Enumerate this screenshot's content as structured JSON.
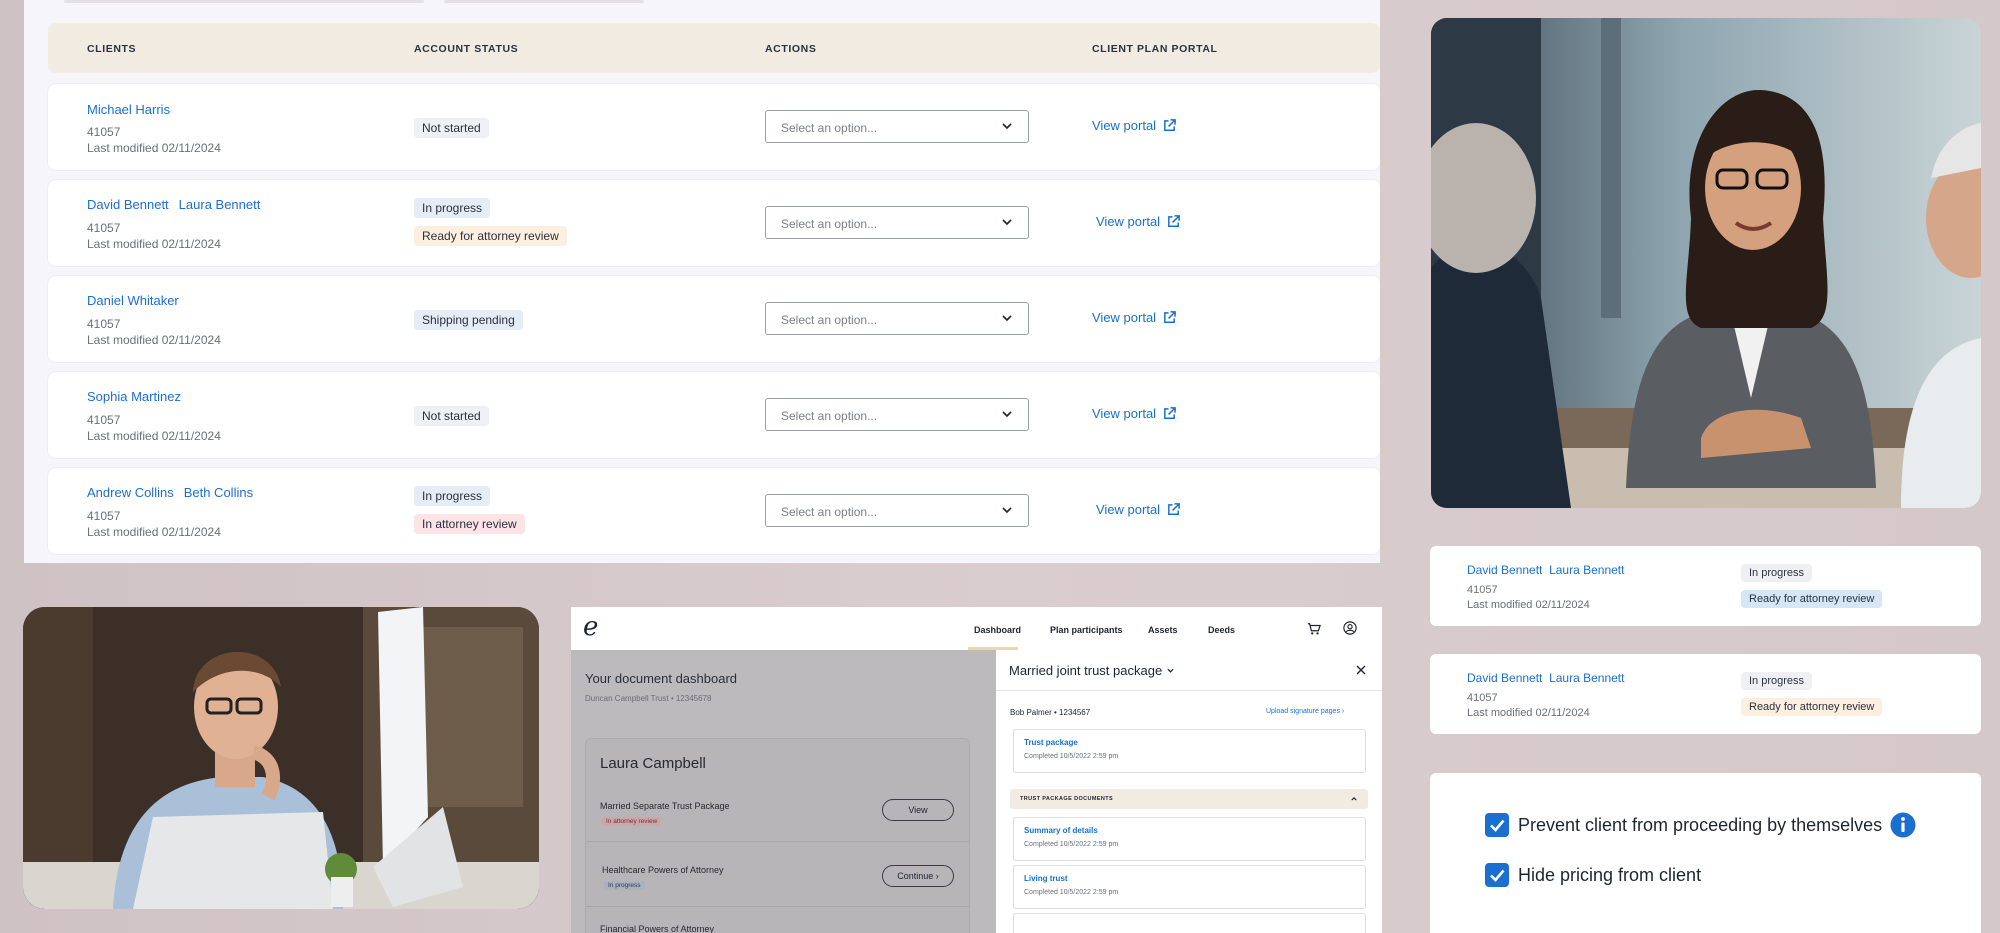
{
  "table": {
    "headers": {
      "clients": "CLIENTS",
      "status": "ACCOUNT STATUS",
      "actions": "ACTIONS",
      "portal": "CLIENT PLAN PORTAL"
    },
    "select_placeholder": "Select an option...",
    "portal_label": "View portal",
    "rows": [
      {
        "names": [
          "Michael Harris"
        ],
        "id": "41057",
        "modified": "Last modified 02/11/2024",
        "badges": [
          "Not started"
        ]
      },
      {
        "names": [
          "David Bennett",
          "Laura Bennett"
        ],
        "id": "41057",
        "modified": "Last modified 02/11/2024",
        "badges": [
          "In progress",
          "Ready for attorney review"
        ]
      },
      {
        "names": [
          "Daniel Whitaker"
        ],
        "id": "41057",
        "modified": "Last modified 02/11/2024",
        "badges": [
          "Shipping pending"
        ]
      },
      {
        "names": [
          "Sophia Martinez"
        ],
        "id": "41057",
        "modified": "Last modified 02/11/2024",
        "badges": [
          "Not started"
        ]
      },
      {
        "names": [
          "Andrew Collins",
          "Beth Collins"
        ],
        "id": "41057",
        "modified": "Last modified 02/11/2024",
        "badges": [
          "In progress",
          "In attorney review"
        ]
      }
    ]
  },
  "cards": [
    {
      "names": [
        "David Bennett",
        "Laura Bennett"
      ],
      "id": "41057",
      "modified": "Last modified 02/11/2024",
      "badges": [
        "In progress",
        "Ready for attorney review"
      ]
    },
    {
      "names": [
        "David Bennett",
        "Laura Bennett"
      ],
      "id": "41057",
      "modified": "Last modified 02/11/2024",
      "badges": [
        "In progress",
        "Ready for attorney review"
      ]
    }
  ],
  "dashboard": {
    "logo": "e",
    "nav": [
      "Dashboard",
      "Plan participants",
      "Assets",
      "Deeds"
    ],
    "title": "Your document dashboard",
    "subtitle": "Duncan Campbell Trust • 12345678",
    "client_name": "Laura Campbell",
    "items": [
      {
        "name": "Married Separate Trust Package",
        "badge": "In attorney review",
        "button": "View"
      },
      {
        "name": "Healthcare Powers of Attorney",
        "badge": "In progress",
        "button": "Continue"
      },
      {
        "name": "Financial Powers of Attorney",
        "badge": "",
        "button": ""
      }
    ],
    "drawer": {
      "title": "Married joint trust package",
      "person": "Bob Palmer • 1234567",
      "upload": "Upload signature pages",
      "section": "TRUST PACKAGE DOCUMENTS",
      "docs": [
        {
          "title": "Trust package",
          "completed": "Completed 10/5/2022 2:59 pm"
        },
        {
          "title": "Summary of details",
          "completed": "Completed 10/5/2022 2:59 pm"
        },
        {
          "title": "Living trust",
          "completed": "Completed 10/5/2022 2:59 pm"
        }
      ]
    }
  },
  "settings": {
    "options": [
      {
        "label": "Prevent client from proceeding by themselves",
        "checked": true
      },
      {
        "label": "Hide pricing from client",
        "checked": true
      }
    ]
  },
  "colors": {
    "accent": "#1b6fd1",
    "header_bg": "#f1ebe2"
  }
}
